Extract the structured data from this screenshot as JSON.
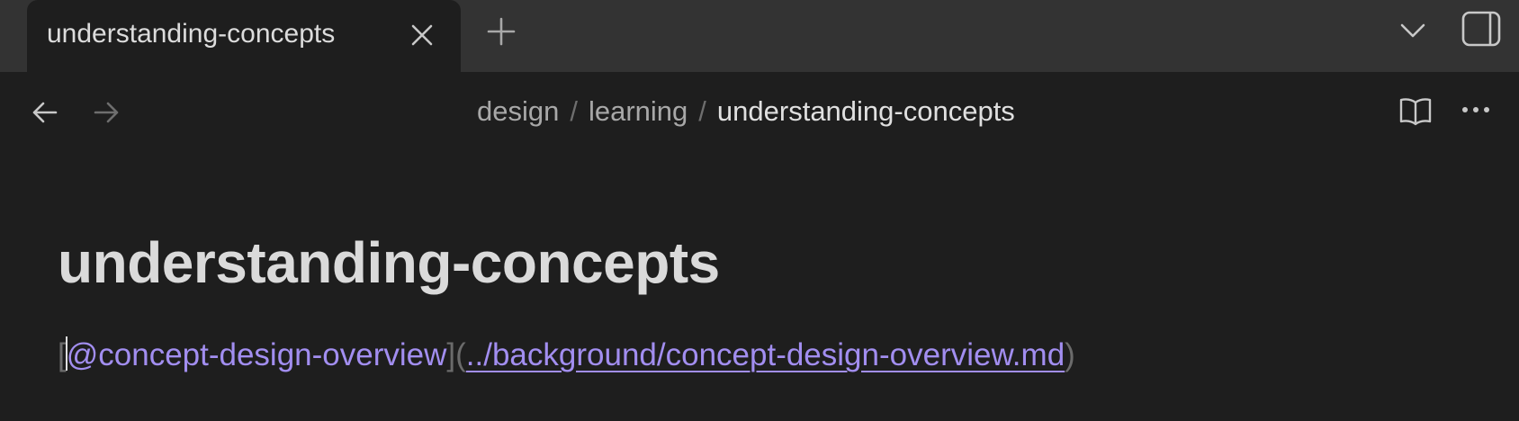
{
  "tabs": [
    {
      "label": "understanding-concepts",
      "active": true
    }
  ],
  "icons": {
    "close": "close-icon",
    "new_tab": "plus-icon",
    "tab_list": "chevron-down-icon",
    "sidebar_toggle": "sidebar-toggle-icon",
    "back": "arrow-left-icon",
    "forward": "arrow-right-icon",
    "reading_view": "book-open-icon",
    "more": "more-options-icon"
  },
  "breadcrumb": {
    "items": [
      "design",
      "learning",
      "understanding-concepts"
    ],
    "separator": "/"
  },
  "document": {
    "title": "understanding-concepts",
    "line": {
      "open_bracket": "[",
      "link_text": "@concept-design-overview",
      "mid": "](",
      "link_url": "../background/concept-design-overview.md",
      "close_paren": ")"
    }
  },
  "colors": {
    "background": "#1e1e1e",
    "tabbar": "#333333",
    "link": "#a28ef0",
    "text": "#dadada",
    "muted": "#6b6b6b"
  }
}
